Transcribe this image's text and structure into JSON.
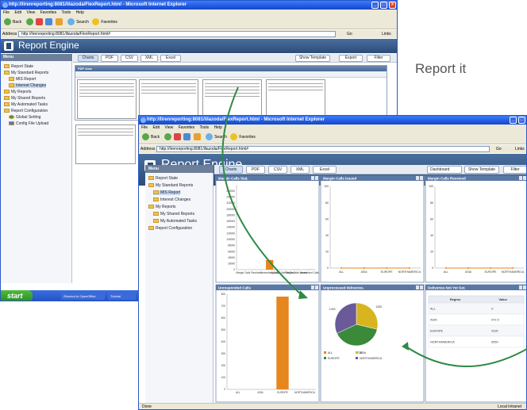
{
  "caption": {
    "text": "Report it"
  },
  "back_window": {
    "title": "http://lirenreporting:8081/lilazoda/FlexReport.html - Microsoft Internet Explorer",
    "menu": [
      "File",
      "Edit",
      "View",
      "Favorites",
      "Tools",
      "Help"
    ],
    "toolbar": {
      "back": "Back",
      "search": "Search",
      "favorites": "Favorites"
    },
    "address_label": "Address",
    "address": "http://lirenreporting:8081/lilazoda/FlexReport.html#",
    "go": "Go",
    "links": "Links",
    "app_title": "Report Engine",
    "menu_header": "Menu",
    "tree": [
      "Report State",
      "My Standard Reports",
      "MIS Report",
      "Interest Changes",
      "My Reports",
      "My Shared Reports",
      "My Automated Tasks",
      "Report Configuration",
      "Global Setting",
      "Config File Upload"
    ],
    "buttons": [
      "Charts",
      "PDF",
      "CSV",
      "XML",
      "Excel"
    ],
    "right_buttons": [
      "Show Template",
      "Export",
      "Filter"
    ],
    "pdf_view_label": "PDF view",
    "start": "start",
    "taskbar_items": [
      "Shortcut to OpenOffice",
      "Tutorial"
    ]
  },
  "front_window": {
    "title": "http://lirenreporting:8081/lilazoda/FlexReport.html - Microsoft Internet Explorer",
    "menu": [
      "File",
      "Edit",
      "View",
      "Favorites",
      "Tools",
      "Help"
    ],
    "toolbar": {
      "back": "Back",
      "search": "Search",
      "favorites": "Favorites"
    },
    "address_label": "Address",
    "address": "http://lirenreporting:8081/lilazoda/FlexReport.html#",
    "go": "Go",
    "links": "Links",
    "app_title": "Report Engine",
    "menu_header": "Menu",
    "tree": [
      "Report State",
      "My Standard Reports",
      "MIS Report",
      "Interest Changes",
      "My Reports",
      "My Shared Reports",
      "My Automated Tasks",
      "Report Configuration"
    ],
    "buttons": [
      "Charts",
      "PDF",
      "CSV",
      "XML",
      "Excel"
    ],
    "dashboard_select": "Dashboard",
    "right_buttons": [
      "Show Template",
      "Filter"
    ],
    "status_left": "Done",
    "status_right": "Local intranet",
    "colors": {
      "orange": "#e6861f",
      "yellow": "#d8b41e",
      "purple": "#6a5a9a",
      "green": "#3a8a3a",
      "arrow": "#2e8a46"
    }
  },
  "chart_data": [
    {
      "type": "bar",
      "title": "Margin Calls Stat.",
      "categories": [
        "Margin Calls",
        "Resolved",
        "Unresolved Calls",
        "Approval Not Yet Sent",
        "Margin Calls Issued",
        "Unresolved Calls"
      ],
      "values": [
        0,
        0,
        32000,
        0,
        500,
        600
      ],
      "ylim": [
        0,
        280000
      ],
      "ticks": [
        "0",
        "10000",
        "20000",
        "30000",
        "40000",
        "50000",
        "60000",
        "70000",
        "80000",
        "90000",
        "100000",
        "110000",
        "120000",
        "130000",
        "140000",
        "150000",
        "160000",
        "170000",
        "180000",
        "190000",
        "200000",
        "210000",
        "220000",
        "230000",
        "240000",
        "250000",
        "260000"
      ]
    },
    {
      "type": "line",
      "title": "Margin Calls Issued",
      "categories": [
        "ALL",
        "ASIA",
        "EUROPE",
        "NORTHAMERICA"
      ],
      "values": [
        0,
        0,
        0,
        0
      ],
      "ylim": [
        0,
        100
      ],
      "ticks": [
        "0",
        "20",
        "40",
        "60",
        "80",
        "100"
      ]
    },
    {
      "type": "line",
      "title": "Margin Calls Received",
      "categories": [
        "ALL",
        "ASIA",
        "EUROPE",
        "NORTHAMERICA"
      ],
      "values": [
        0,
        0,
        0,
        0
      ],
      "ylim": [
        0,
        100
      ],
      "ticks": [
        "0",
        "20",
        "40",
        "60",
        "80",
        "100"
      ]
    },
    {
      "type": "bar",
      "title": "Unresponded Calls",
      "categories": [
        "ALL",
        "ASIA",
        "EUROPE",
        "NORTHAMERICA"
      ],
      "values": [
        0,
        0,
        780,
        0
      ],
      "ylim": [
        0,
        800
      ],
      "ticks": [
        "0",
        "100",
        "200",
        "300",
        "400",
        "500",
        "600",
        "700",
        "800"
      ]
    },
    {
      "type": "pie",
      "title": "Unprocessed deliveries.",
      "categories": [
        "ALL",
        "ASIA",
        "EUROPE",
        "NORTHAMERICA"
      ],
      "values": [
        0,
        1260,
        1725,
        1400
      ],
      "data_labels": [
        "1260",
        "1725",
        "1400",
        "0"
      ],
      "legend": "bottom-left"
    },
    {
      "type": "table",
      "title": "Deliveries Not Yet Set.",
      "columns": [
        "Region",
        "Value"
      ],
      "rows": [
        [
          "ALL",
          "0"
        ],
        [
          "ASIA",
          "672.5"
        ],
        [
          "EUROPE",
          "9130"
        ],
        [
          "NORTHAMERICA",
          "6050"
        ]
      ]
    }
  ]
}
